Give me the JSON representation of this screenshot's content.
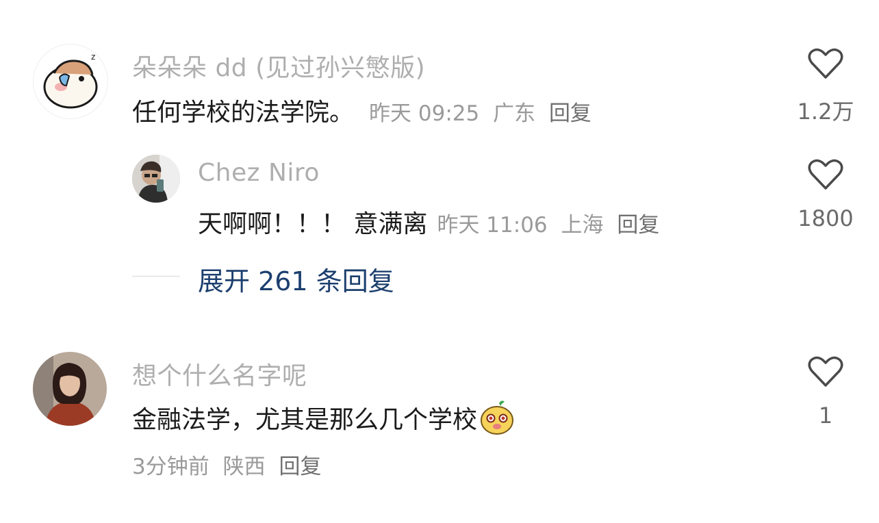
{
  "comments": [
    {
      "username": "朵朵朵 dd (见过孙兴慜版)",
      "text": "任何学校的法学院。",
      "time": "昨天 09:25",
      "location": "广东",
      "reply_label": "回复",
      "likes": "1.2万",
      "avatar_icon": "hamster-sticker-icon",
      "replies": [
        {
          "username": "Chez Niro",
          "text": "天啊啊！！！ 意满离",
          "time": "昨天 11:06",
          "location": "上海",
          "reply_label": "回复",
          "likes": "1800",
          "avatar_icon": "selfie-photo-icon"
        }
      ],
      "expand_label": "展开 261 条回复"
    },
    {
      "username": "想个什么名字呢",
      "text": "金融法学，尤其是那么几个学校",
      "emoji": "dog-face-emoji",
      "time": "3分钟前",
      "location": "陕西",
      "reply_label": "回复",
      "likes": "1",
      "avatar_icon": "woman-portrait-icon"
    }
  ],
  "colors": {
    "link": "#1c3f6e",
    "name": "#aeaeae",
    "text": "#1b1b1b"
  }
}
